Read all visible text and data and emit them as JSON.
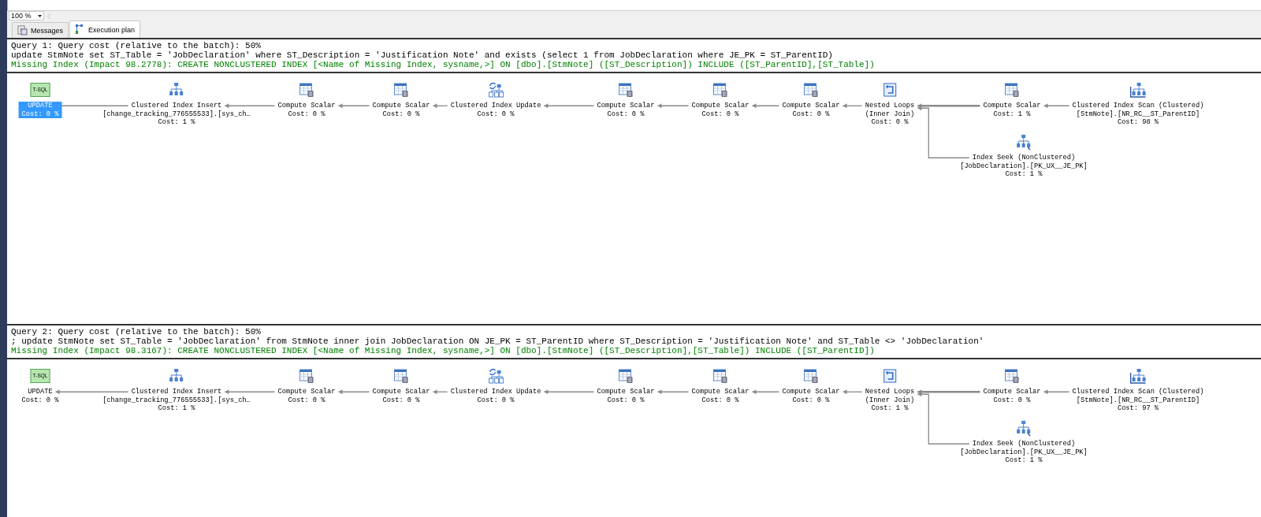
{
  "zoom": {
    "value": "100 %"
  },
  "tabs": [
    {
      "kind": "messages",
      "label": "Messages",
      "selected": false
    },
    {
      "kind": "plan",
      "label": "Execution plan",
      "selected": true
    }
  ],
  "queries": [
    {
      "title": "Query 1: Query cost (relative to the batch): 50%",
      "statement": "update StmNote set ST_Table = 'JobDeclaration' where ST_Description = 'Justification Note' and exists (select 1 from JobDeclaration where JE_PK = ST_ParentID)",
      "missing_index": "Missing Index (Impact 98.2778): CREATE NONCLUSTERED INDEX [<Name of Missing Index, sysname,>] ON [dbo].[StmNote] ([ST_Description]) INCLUDE ([ST_ParentID],[ST_Table])",
      "nodes": [
        {
          "kind": "tsql",
          "badge": "T-SQL",
          "lines": [
            "UPDATE"
          ],
          "cost": "Cost: 0 %",
          "selected": true
        },
        {
          "kind": "insert",
          "lines": [
            "Clustered Index Insert",
            "[change_tracking_776555533].[sys_ch…"
          ],
          "cost": "Cost: 1 %",
          "selected": false
        },
        {
          "kind": "compute",
          "lines": [
            "Compute Scalar"
          ],
          "cost": "Cost: 0 %",
          "selected": false
        },
        {
          "kind": "compute",
          "lines": [
            "Compute Scalar"
          ],
          "cost": "Cost: 0 %",
          "selected": false
        },
        {
          "kind": "update",
          "lines": [
            "Clustered Index Update"
          ],
          "cost": "Cost: 0 %",
          "selected": false
        },
        {
          "kind": "compute",
          "lines": [
            "Compute Scalar"
          ],
          "cost": "Cost: 0 %",
          "selected": false
        },
        {
          "kind": "compute",
          "lines": [
            "Compute Scalar"
          ],
          "cost": "Cost: 0 %",
          "selected": false
        },
        {
          "kind": "compute",
          "lines": [
            "Compute Scalar"
          ],
          "cost": "Cost: 0 %",
          "selected": false
        },
        {
          "kind": "nested",
          "lines": [
            "Nested Loops",
            "(Inner Join)"
          ],
          "cost": "Cost: 0 %",
          "selected": false
        },
        {
          "kind": "compute",
          "lines": [
            "Compute Scalar"
          ],
          "cost": "Cost: 1 %",
          "selected": false
        },
        {
          "kind": "scan",
          "lines": [
            "Clustered Index Scan (Clustered)",
            "[StmNote].[NR_RC__ST_ParentID]"
          ],
          "cost": "Cost: 98 %",
          "selected": false
        },
        {
          "kind": "seek",
          "lines": [
            "Index Seek (NonClustered)",
            "[JobDeclaration].[PK_UX__JE_PK]"
          ],
          "cost": "Cost: 1 %",
          "selected": false
        }
      ]
    },
    {
      "title": "Query 2: Query cost (relative to the batch): 50%",
      "statement": "; update StmNote set ST_Table = 'JobDeclaration' from StmNote inner join JobDeclaration ON JE_PK = ST_ParentID where ST_Description = 'Justification Note' and ST_Table <> 'JobDeclaration'",
      "missing_index": "Missing Index (Impact 98.3167): CREATE NONCLUSTERED INDEX [<Name of Missing Index, sysname,>] ON [dbo].[StmNote] ([ST_Description],[ST_Table]) INCLUDE ([ST_ParentID])",
      "nodes": [
        {
          "kind": "tsql",
          "badge": "T-SQL",
          "lines": [
            "UPDATE"
          ],
          "cost": "Cost: 0 %",
          "selected": false
        },
        {
          "kind": "insert",
          "lines": [
            "Clustered Index Insert",
            "[change_tracking_776555533].[sys_ch…"
          ],
          "cost": "Cost: 1 %",
          "selected": false
        },
        {
          "kind": "compute",
          "lines": [
            "Compute Scalar"
          ],
          "cost": "Cost: 0 %",
          "selected": false
        },
        {
          "kind": "compute",
          "lines": [
            "Compute Scalar"
          ],
          "cost": "Cost: 0 %",
          "selected": false
        },
        {
          "kind": "update",
          "lines": [
            "Clustered Index Update"
          ],
          "cost": "Cost: 0 %",
          "selected": false
        },
        {
          "kind": "compute",
          "lines": [
            "Compute Scalar"
          ],
          "cost": "Cost: 0 %",
          "selected": false
        },
        {
          "kind": "compute",
          "lines": [
            "Compute Scalar"
          ],
          "cost": "Cost: 0 %",
          "selected": false
        },
        {
          "kind": "compute",
          "lines": [
            "Compute Scalar"
          ],
          "cost": "Cost: 0 %",
          "selected": false
        },
        {
          "kind": "nested",
          "lines": [
            "Nested Loops",
            "(Inner Join)"
          ],
          "cost": "Cost: 1 %",
          "selected": false
        },
        {
          "kind": "compute",
          "lines": [
            "Compute Scalar"
          ],
          "cost": "Cost: 0 %",
          "selected": false
        },
        {
          "kind": "scan",
          "lines": [
            "Clustered Index Scan (Clustered)",
            "[StmNote].[NR_RC__ST_ParentID]"
          ],
          "cost": "Cost: 97 %",
          "selected": false
        },
        {
          "kind": "seek",
          "lines": [
            "Index Seek (NonClustered)",
            "[JobDeclaration].[PK_UX__JE_PK]"
          ],
          "cost": "Cost: 1 %",
          "selected": false
        }
      ]
    }
  ]
}
